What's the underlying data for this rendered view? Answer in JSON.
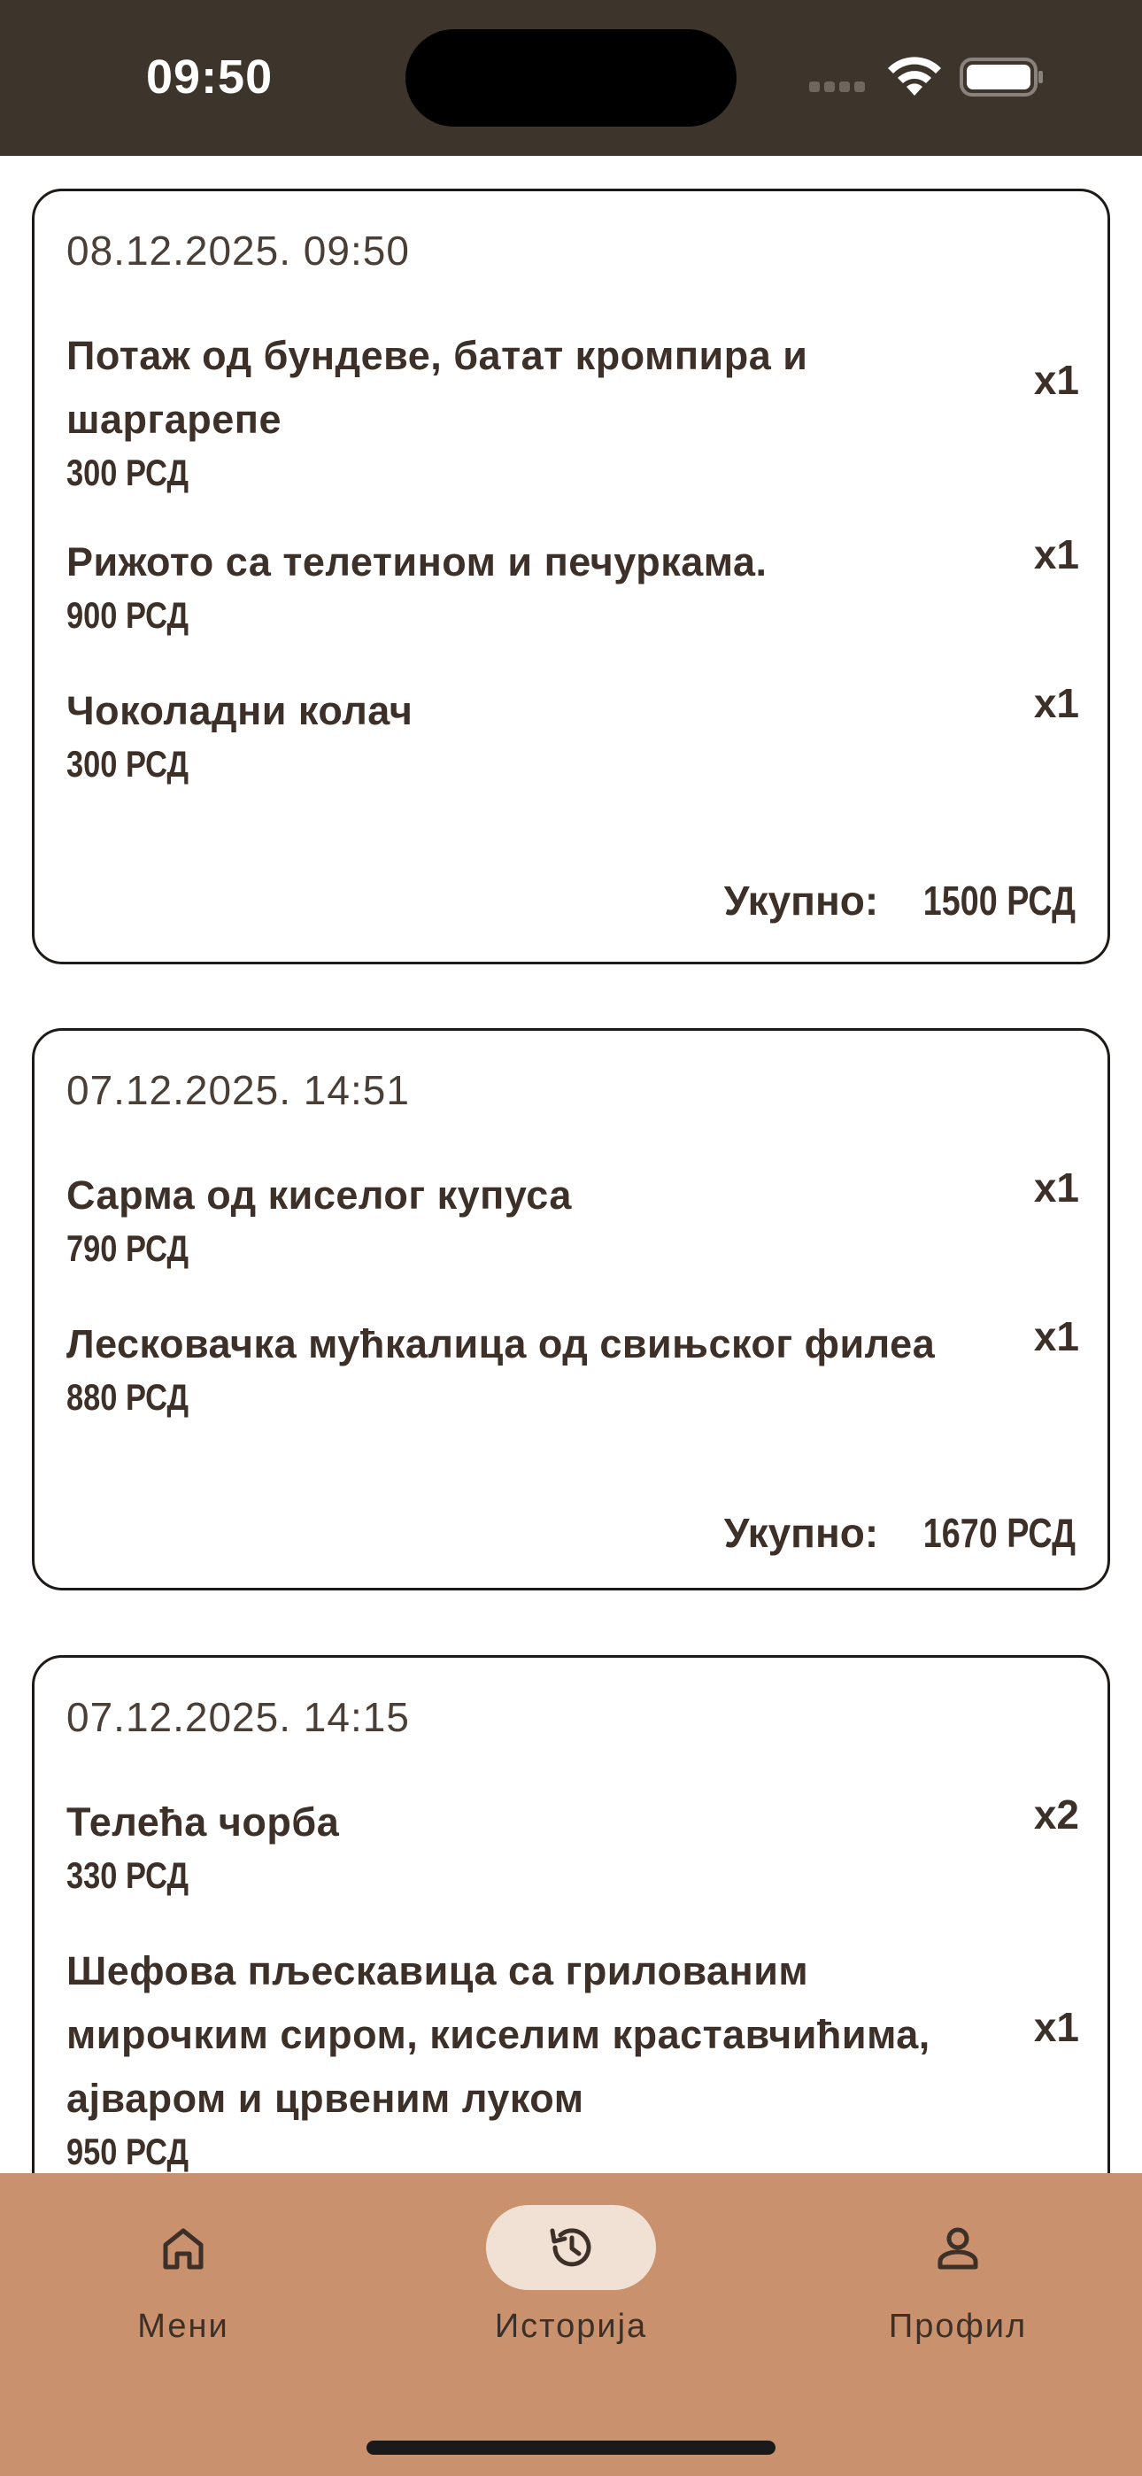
{
  "status_bar": {
    "time": "09:50"
  },
  "orders": [
    {
      "date": "08.12.2025. 09:50",
      "items": [
        {
          "name": "Потаж од бундеве, батат кромпира и шаргарепе",
          "price": "300 РСД",
          "qty": "x1"
        },
        {
          "name": "Рижото са телетином и печуркама.",
          "price": "900 РСД",
          "qty": "x1"
        },
        {
          "name": "Чоколадни колач",
          "price": "300 РСД",
          "qty": "x1"
        }
      ],
      "total_label": "Укупно:",
      "total_value": "1500 РСД"
    },
    {
      "date": "07.12.2025. 14:51",
      "items": [
        {
          "name": "Сарма од киселог купуса",
          "price": "790 РСД",
          "qty": "x1"
        },
        {
          "name": "Лесковачка мућкалица од свињског филеа",
          "price": "880 РСД",
          "qty": "x1"
        }
      ],
      "total_label": "Укупно:",
      "total_value": "1670 РСД"
    },
    {
      "date": "07.12.2025. 14:15",
      "items": [
        {
          "name": "Телећа чорба",
          "price": "330 РСД",
          "qty": "x2"
        },
        {
          "name": "Шефова пљескавица са грилованим мирочким сиром, киселим краставчићима, ајваром и црвеним луком",
          "price": "950 РСД",
          "qty": "x1"
        }
      ]
    }
  ],
  "nav": {
    "items": [
      {
        "label": "Мени",
        "icon": "home-icon"
      },
      {
        "label": "Историја",
        "icon": "history-icon",
        "active": true
      },
      {
        "label": "Профил",
        "icon": "person-icon"
      }
    ]
  },
  "colors": {
    "status_bar_bg": "#3d342c",
    "nav_bg": "#c9916d",
    "nav_active_pill": "#f1e0d4",
    "text": "#3d3028"
  }
}
